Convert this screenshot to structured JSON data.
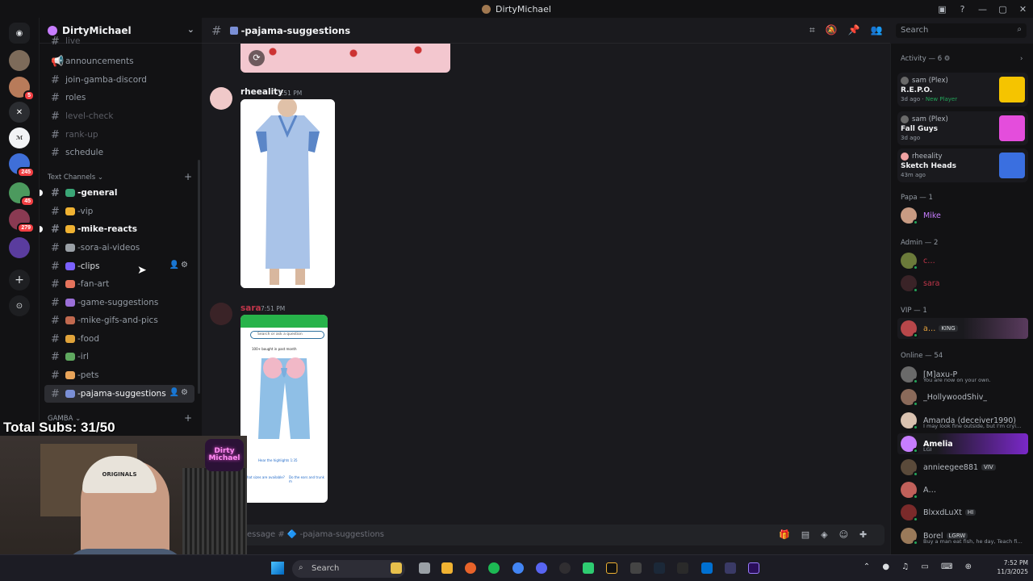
{
  "window": {
    "title": "DirtyMichael",
    "controls": [
      "▣",
      "?",
      "—",
      "▢",
      "✕"
    ]
  },
  "server": {
    "name": "DirtyMichael"
  },
  "rail": {
    "badges": [
      "5",
      "245",
      "45",
      "279"
    ]
  },
  "channels_top": [
    {
      "label": "live",
      "kind": "text",
      "state": "dim"
    },
    {
      "label": "announcements",
      "kind": "announce",
      "state": "normal"
    },
    {
      "label": "join-gamba-discord",
      "kind": "text",
      "state": "normal"
    },
    {
      "label": "roles",
      "kind": "text",
      "state": "normal"
    },
    {
      "label": "level-check",
      "kind": "text",
      "state": "dim"
    },
    {
      "label": "rank-up",
      "kind": "text",
      "state": "dim"
    },
    {
      "label": "schedule",
      "kind": "text",
      "state": "normal"
    }
  ],
  "category_text": "Text Channels",
  "channels_text": [
    {
      "label": "-general",
      "emoji_color": "#3aa676",
      "state": "bright"
    },
    {
      "label": "-vip",
      "emoji_color": "#f0b232",
      "state": "normal"
    },
    {
      "label": "-mike-reacts",
      "emoji_color": "#f0b232",
      "state": "bright"
    },
    {
      "label": "-sora-ai-videos",
      "emoji_color": "#9aa0a6",
      "state": "normal"
    },
    {
      "label": "-clips",
      "emoji_color": "#7b61ff",
      "state": "hover"
    },
    {
      "label": "-fan-art",
      "emoji_color": "#e5735c",
      "state": "normal"
    },
    {
      "label": "-game-suggestions",
      "emoji_color": "#9b6fd8",
      "state": "normal"
    },
    {
      "label": "-mike-gifs-and-pics",
      "emoji_color": "#c1694f",
      "state": "normal"
    },
    {
      "label": "-food",
      "emoji_color": "#e0a33a",
      "state": "normal"
    },
    {
      "label": "-irl",
      "emoji_color": "#5fa85f",
      "state": "normal"
    },
    {
      "label": "-pets",
      "emoji_color": "#e8a45a",
      "state": "normal"
    },
    {
      "label": "-pajama-suggestions",
      "emoji_color": "#7a8fd6",
      "state": "active"
    }
  ],
  "category_gamba": "GAMBA",
  "overlay": {
    "subs_text": "Total Subs: 31/50",
    "neon": "Dirty Michael",
    "cap": "ORIGINALS"
  },
  "chat": {
    "channel_title": "-pajama-suggestions",
    "messages": [
      {
        "author": "rheeality",
        "time": "7:51 PM",
        "color": "#f2f3f5"
      },
      {
        "author": "sara",
        "time": "7:51 PM",
        "color": "#c0364a"
      }
    ],
    "phone": {
      "search": "Search or ask a question",
      "bought": "100+ bought in past month",
      "highlights": "Hear the highlights 1:35",
      "q1": "What sizes are available?",
      "q2": "Do the ears and trunk m"
    },
    "composer_placeholder": "essage # 🔷 -pajama-suggestions"
  },
  "search": {
    "placeholder": "Search"
  },
  "members": {
    "activity_header": "Activity — 6 ⚙",
    "activities": [
      {
        "who": "sam (Plex)",
        "game": "R.E.P.O.",
        "ago": "3d ago",
        "extra": "New Player",
        "art": "#f5c400"
      },
      {
        "who": "sam (Plex)",
        "game": "Fall Guys",
        "ago": "3d ago",
        "extra": "",
        "art": "#e44ddc"
      },
      {
        "who": "rheeality",
        "game": "Sketch Heads",
        "ago": "43m ago",
        "extra": "",
        "art": "#3a6fe0"
      }
    ],
    "groups": [
      {
        "title": "Papa — 1",
        "items": [
          {
            "name": "Mike",
            "color": "#c77dff",
            "status": "",
            "tag": ""
          }
        ]
      },
      {
        "title": "Admin — 2",
        "items": [
          {
            "name": "c…",
            "color": "#c0364a",
            "status": "",
            "tag": ""
          },
          {
            "name": "sara",
            "color": "#c0364a",
            "status": "",
            "tag": ""
          }
        ]
      },
      {
        "title": "VIP — 1",
        "items": [
          {
            "name": "a…",
            "color": "#e6a23c",
            "status": "",
            "tag": "KING"
          }
        ]
      },
      {
        "title": "Online — 54",
        "items": [
          {
            "name": "[M]axu-P",
            "color": "#b5bac1",
            "status": "You are now on your own.",
            "tag": ""
          },
          {
            "name": "_HollywoodShiv_",
            "color": "#b5bac1",
            "status": "",
            "tag": ""
          },
          {
            "name": "Amanda (deceiver1990)",
            "color": "#b5bac1",
            "status": "I may look fine outside, but I'm cryi…",
            "tag": ""
          },
          {
            "name": "Amelia",
            "color": "#ffffff",
            "status": "LGI",
            "tag": ""
          },
          {
            "name": "annieegee881",
            "color": "#b5bac1",
            "status": "",
            "tag": "VIV"
          },
          {
            "name": "A…",
            "color": "#b5bac1",
            "status": "",
            "tag": ""
          },
          {
            "name": "BlxxdLuXt",
            "color": "#b5bac1",
            "status": "",
            "tag": "HI"
          },
          {
            "name": "Borel",
            "color": "#b5bac1",
            "status": "Buy a man eat fish, he day, Teach fi…",
            "tag": "LGRW"
          }
        ]
      }
    ]
  },
  "taskbar": {
    "search": "Search",
    "time": "7:52 PM",
    "date": "11/3/2025"
  }
}
